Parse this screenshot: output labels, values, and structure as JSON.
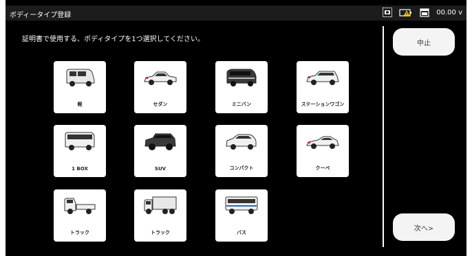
{
  "statusbar": {
    "title": "ボディータイプ登録",
    "voltage": "00.00 v"
  },
  "instruction": "証明書で使用する、ボディタイプを1つ選択してください。",
  "buttons": {
    "cancel": "中止",
    "next": "次へ>"
  },
  "body_types": [
    {
      "label": "軽"
    },
    {
      "label": "セダン"
    },
    {
      "label": "ミニバン"
    },
    {
      "label": "ステーションワゴン"
    },
    {
      "label": "1 BOX"
    },
    {
      "label": "SUV"
    },
    {
      "label": "コンパクト"
    },
    {
      "label": "クーペ"
    },
    {
      "label": "トラック"
    },
    {
      "label": "トラック"
    },
    {
      "label": "バス"
    }
  ],
  "icons": {
    "camera": "camera-icon",
    "battery": "battery-warning-icon",
    "calendar": "calendar-icon"
  }
}
